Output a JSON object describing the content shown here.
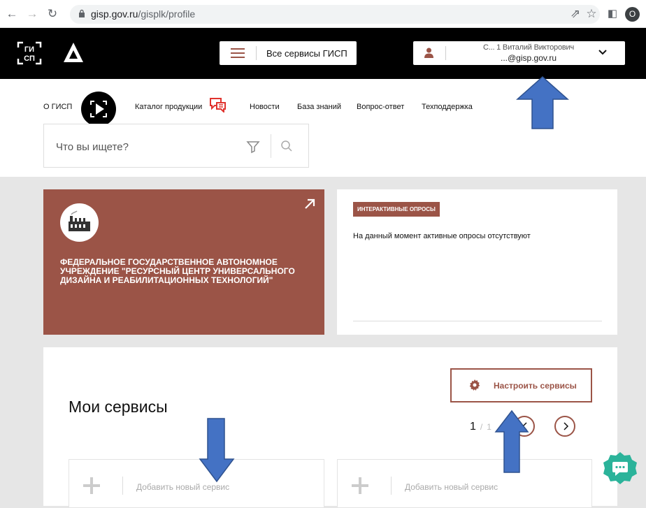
{
  "browser": {
    "url_host": "gisp.gov.ru",
    "url_path": "/gisplk/profile",
    "profile_initial": "O"
  },
  "header": {
    "logo_text": "ГИ СП",
    "all_services_label": "Все сервисы ГИСП",
    "user_name": "С...  1 Виталий Викторович",
    "user_email": "...@gisp.gov.ru"
  },
  "nav": {
    "items": [
      {
        "label": "О ГИСП"
      },
      {
        "label": "Каталог продукции"
      },
      {
        "label": "Новости"
      },
      {
        "label": "База знаний"
      },
      {
        "label": "Вопрос-ответ"
      },
      {
        "label": "Техподдержка"
      }
    ],
    "search_placeholder": "Что вы ищете?"
  },
  "org_card": {
    "name": "ФЕДЕРАЛЬНОЕ ГОСУДАРСТВЕННОЕ АВТОНОМНОЕ УЧРЕЖДЕНИЕ \"РЕСУРСНЫЙ ЦЕНТР УНИВЕРСАЛЬНОГО ДИЗАЙНА И РЕАБИЛИТАЦИОННЫХ ТЕХНОЛОГИЙ\""
  },
  "survey_card": {
    "badge": "ИНТЕРАКТИВНЫЕ ОПРОСЫ",
    "message": "На данный момент активные опросы отсутствуют"
  },
  "services": {
    "title": "Мои сервисы",
    "configure_label": "Настроить сервисы",
    "page_current": "1",
    "page_separator": "/",
    "page_total": "1",
    "slots": [
      {
        "label": "Добавить новый сервис"
      },
      {
        "label": "Добавить новый сервис"
      }
    ]
  },
  "colors": {
    "accent": "#9b5447",
    "header_bg": "#000000",
    "page_bg": "#e6e6e6",
    "chat_green": "#2bb39a",
    "annotation_arrow": "#4472c4"
  }
}
